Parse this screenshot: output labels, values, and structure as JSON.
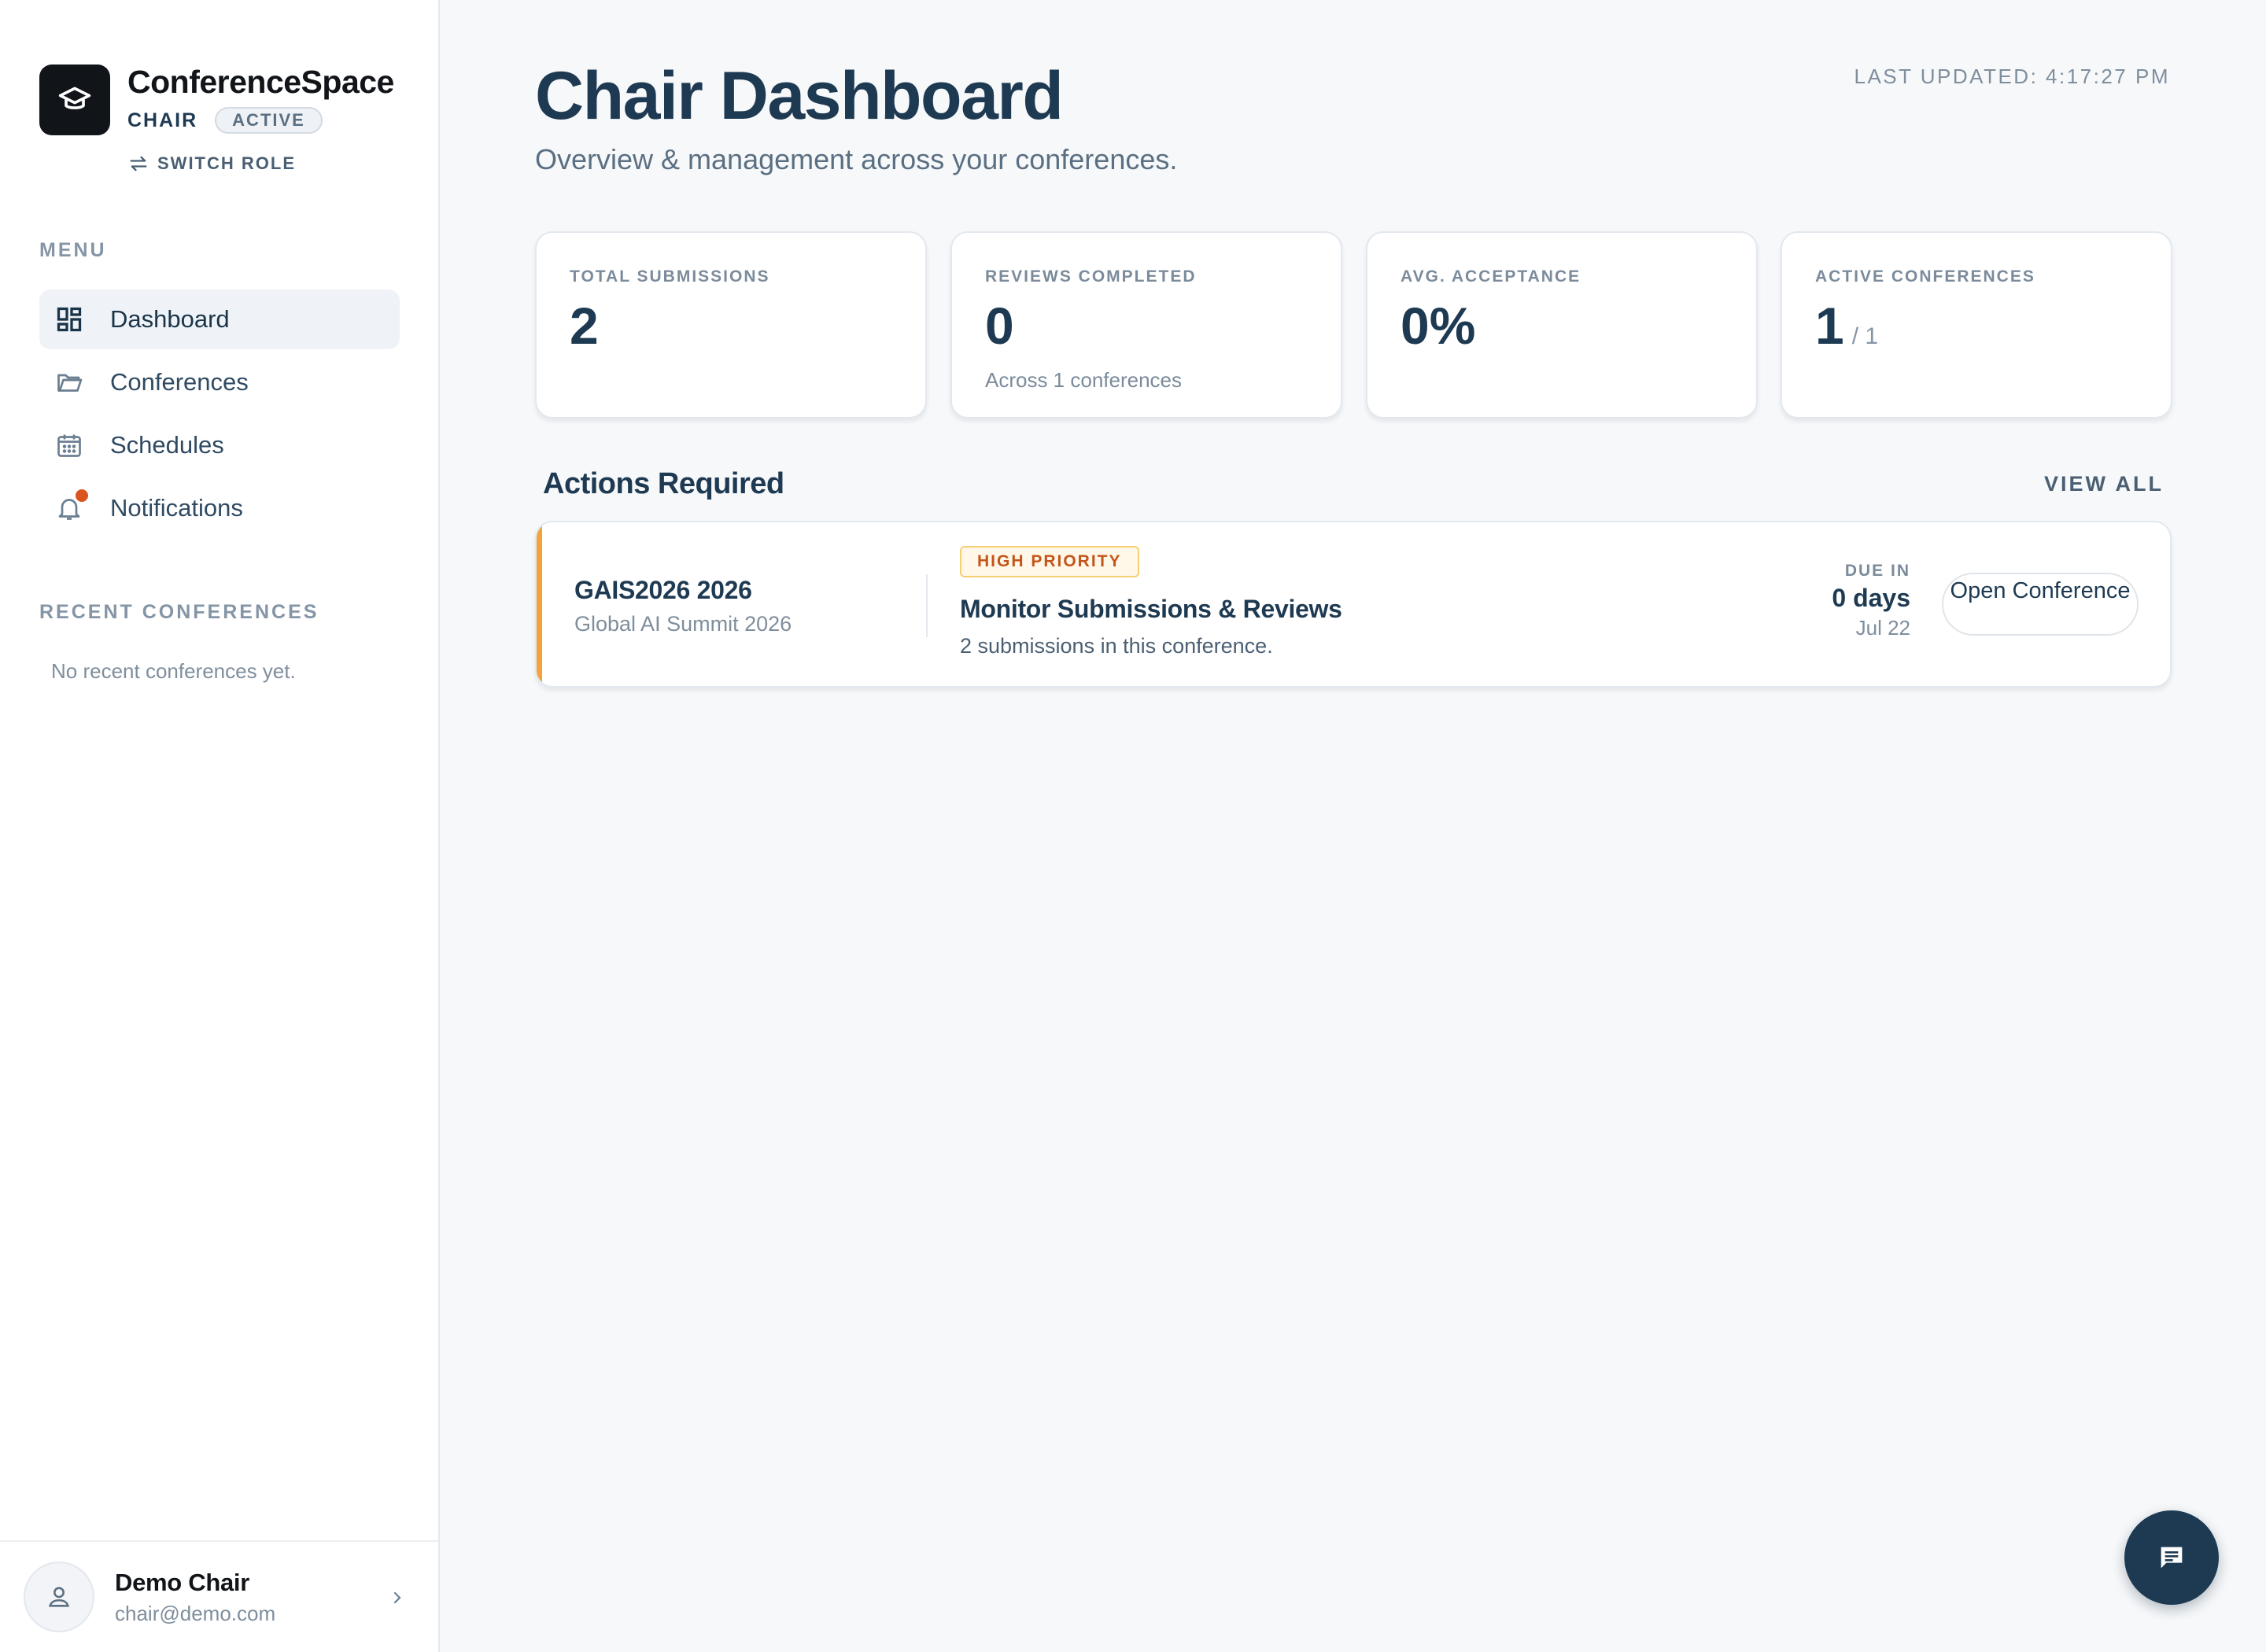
{
  "app": {
    "name": "ConferenceSpace",
    "role": "CHAIR",
    "role_status": "ACTIVE",
    "switch_role": "SWITCH ROLE"
  },
  "sidebar": {
    "menu_label": "MENU",
    "items": [
      {
        "label": "Dashboard",
        "icon": "dashboard-icon",
        "active": true
      },
      {
        "label": "Conferences",
        "icon": "folder-icon"
      },
      {
        "label": "Schedules",
        "icon": "calendar-icon"
      },
      {
        "label": "Notifications",
        "icon": "bell-icon",
        "has_dot": true
      }
    ],
    "recent_label": "RECENT CONFERENCES",
    "recent_empty": "No recent conferences yet."
  },
  "user": {
    "name": "Demo Chair",
    "email": "chair@demo.com"
  },
  "header": {
    "title": "Chair Dashboard",
    "subtitle": "Overview & management across your conferences.",
    "last_updated": "LAST UPDATED: 4:17:27 PM"
  },
  "stats": [
    {
      "label": "TOTAL SUBMISSIONS",
      "value": "2"
    },
    {
      "label": "REVIEWS COMPLETED",
      "value": "0",
      "sub": "Across 1 conferences"
    },
    {
      "label": "AVG. ACCEPTANCE",
      "value": "0%"
    },
    {
      "label": "ACTIVE CONFERENCES",
      "value": "1",
      "of": "/ 1"
    }
  ],
  "actions": {
    "title": "Actions Required",
    "view_all": "VIEW ALL",
    "items": [
      {
        "conf_code": "GAIS2026 2026",
        "conf_name": "Global AI Summit 2026",
        "priority": "HIGH PRIORITY",
        "title": "Monitor Submissions & Reviews",
        "description": "2 submissions in this conference.",
        "due_label": "DUE IN",
        "due_days": "0 days",
        "due_date": "Jul 22",
        "button": "Open Conference"
      }
    ]
  },
  "colors": {
    "primary": "#1e3a52",
    "accent_priority": "#f4a23a",
    "notification_dot": "#d9541e"
  }
}
